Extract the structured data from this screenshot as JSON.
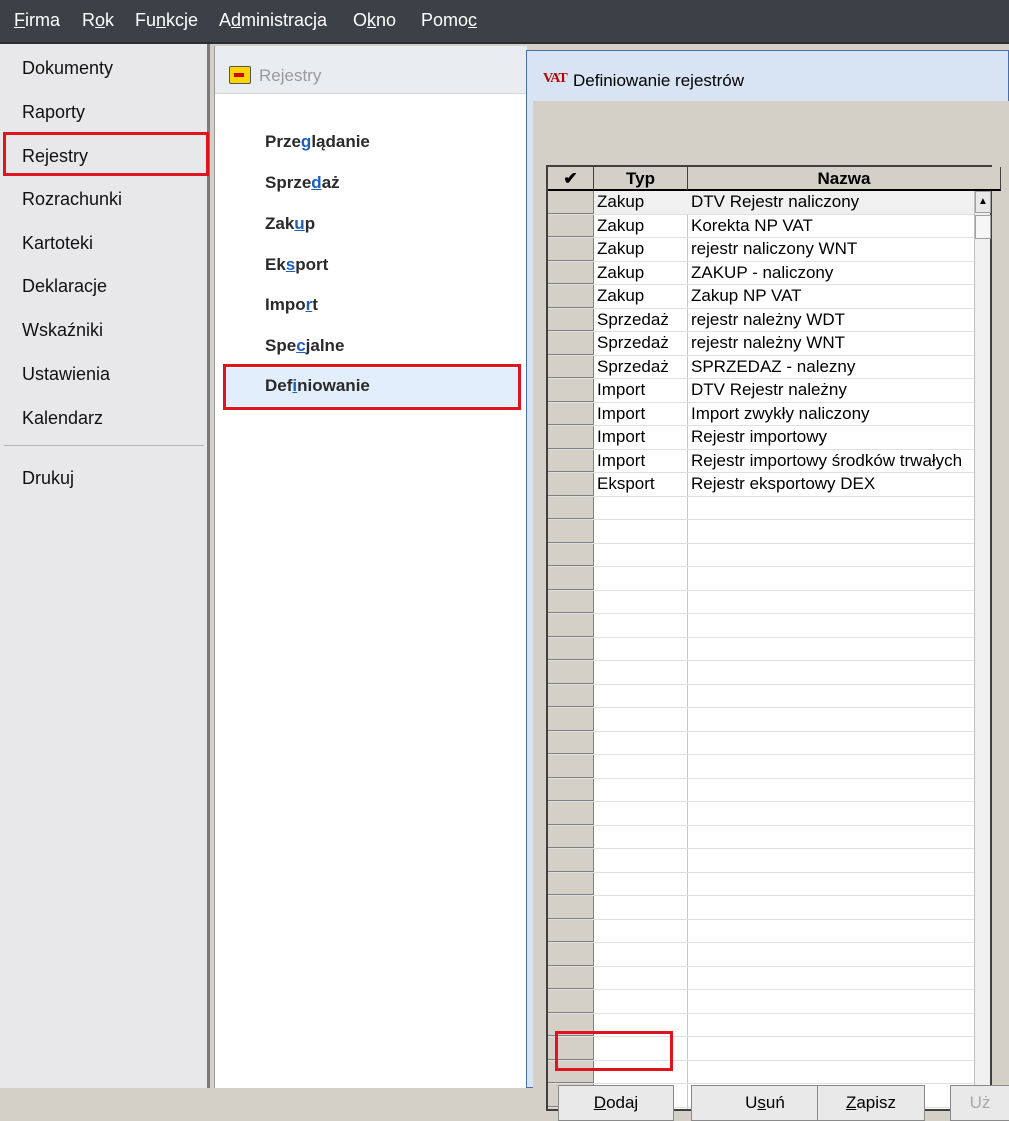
{
  "menu": {
    "items": [
      {
        "pre": "",
        "u": "F",
        "post": "irma"
      },
      {
        "pre": "R",
        "u": "o",
        "post": "k"
      },
      {
        "pre": "Fu",
        "u": "n",
        "post": "kcje"
      },
      {
        "pre": "A",
        "u": "d",
        "post": "ministracja"
      },
      {
        "pre": "O",
        "u": "k",
        "post": "no"
      },
      {
        "pre": "Pomo",
        "u": "c",
        "post": ""
      }
    ]
  },
  "sidebar": {
    "items": [
      "Dokumenty",
      "Raporty",
      "Rejestry",
      "Rozrachunki",
      "Kartoteki",
      "Deklaracje",
      "Wskaźniki",
      "Ustawienia",
      "Kalendarz"
    ],
    "print": "Drukuj"
  },
  "registers_panel": {
    "title": "Rejestry",
    "items": [
      {
        "pre": "Prze",
        "u": "g",
        "post": "lądanie"
      },
      {
        "pre": "Sprze",
        "u": "d",
        "post": "aż"
      },
      {
        "pre": "Zak",
        "u": "u",
        "post": "p"
      },
      {
        "pre": "Ek",
        "u": "s",
        "post": "port"
      },
      {
        "pre": "Impo",
        "u": "r",
        "post": "t"
      },
      {
        "pre": "Spe",
        "u": "c",
        "post": "jalne"
      },
      {
        "pre": "Def",
        "u": "i",
        "post": "niowanie"
      }
    ]
  },
  "dialog": {
    "icon_text": "VAT",
    "title": "Definiowanie rejestrów",
    "columns": {
      "check": "✔",
      "typ": "Typ",
      "nazwa": "Nazwa"
    },
    "rows": [
      {
        "typ": "Zakup",
        "nazwa": "DTV Rejestr naliczony"
      },
      {
        "typ": "Zakup",
        "nazwa": "Korekta NP VAT"
      },
      {
        "typ": "Zakup",
        "nazwa": "rejestr naliczony WNT"
      },
      {
        "typ": "Zakup",
        "nazwa": "ZAKUP - naliczony"
      },
      {
        "typ": "Zakup",
        "nazwa": "Zakup NP VAT"
      },
      {
        "typ": "Sprzedaż",
        "nazwa": "rejestr należny WDT"
      },
      {
        "typ": "Sprzedaż",
        "nazwa": "rejestr należny WNT"
      },
      {
        "typ": "Sprzedaż",
        "nazwa": "SPRZEDAZ - nalezny"
      },
      {
        "typ": "Import",
        "nazwa": " DTV Rejestr należny"
      },
      {
        "typ": "Import",
        "nazwa": "Import zwykły naliczony"
      },
      {
        "typ": "Import",
        "nazwa": "Rejestr importowy"
      },
      {
        "typ": "Import",
        "nazwa": "Rejestr importowy środków trwałych"
      },
      {
        "typ": "Eksport",
        "nazwa": "Rejestr eksportowy DEX"
      }
    ],
    "buttons": {
      "add": {
        "pre": "",
        "u": "D",
        "post": "odaj"
      },
      "remove": {
        "pre": "U",
        "u": "s",
        "post": "uń"
      },
      "save": {
        "pre": "",
        "u": "Z",
        "post": "apisz"
      },
      "use": {
        "pre": "Uż",
        "u": "",
        "post": ""
      }
    }
  },
  "colors": {
    "highlight_box": "#e0141e",
    "menubar": "#3c4147",
    "accent": "#2f6fd0"
  }
}
